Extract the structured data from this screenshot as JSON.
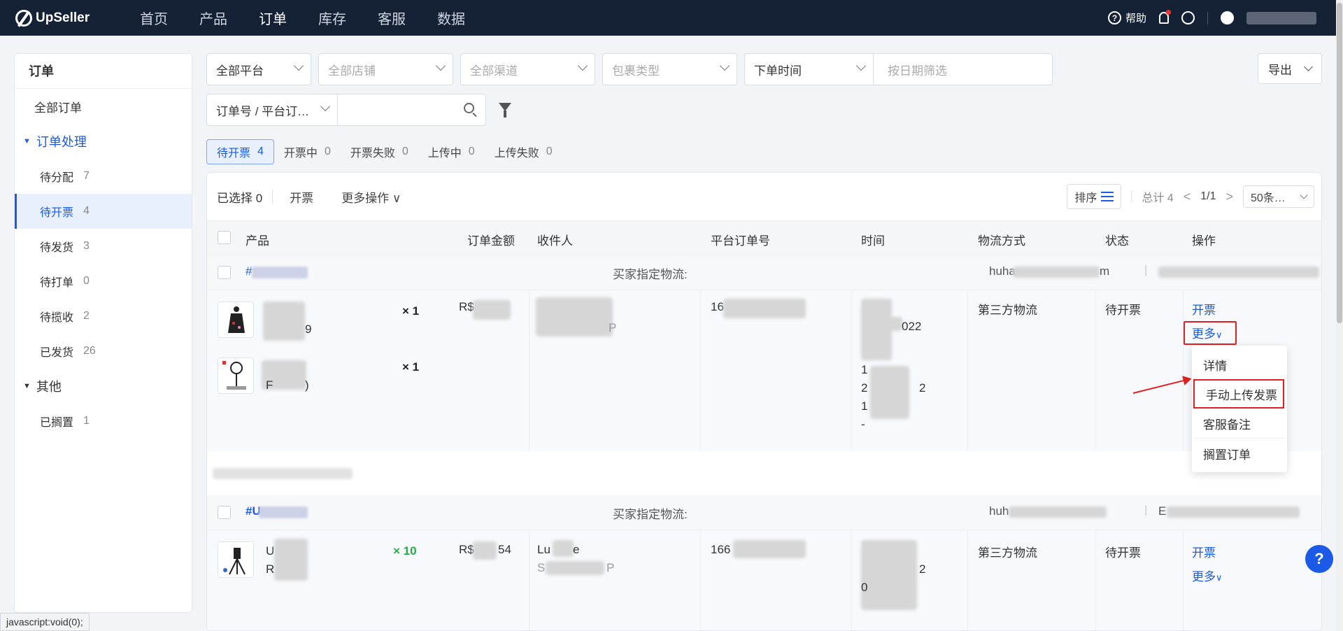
{
  "app": {
    "name": "UpSeller"
  },
  "nav": {
    "items": [
      "首页",
      "产品",
      "订单",
      "库存",
      "客服",
      "数据"
    ],
    "active": "订单"
  },
  "topRight": {
    "help": "帮助"
  },
  "sidebar": {
    "title": "订单",
    "all": "全部订单",
    "group1": "订单处理",
    "items": [
      {
        "label": "待分配",
        "count": "7"
      },
      {
        "label": "待开票",
        "count": "4"
      },
      {
        "label": "待发货",
        "count": "3"
      },
      {
        "label": "待打单",
        "count": "0"
      },
      {
        "label": "待揽收",
        "count": "2"
      },
      {
        "label": "已发货",
        "count": "26"
      }
    ],
    "group2": "其他",
    "other": [
      {
        "label": "已搁置",
        "count": "1"
      }
    ]
  },
  "filters": {
    "platform": "全部平台",
    "store": "全部店铺",
    "channel": "全部渠道",
    "packageType": "包裹类型",
    "timeType": "下单时间",
    "datePlaceholder": "按日期筛选",
    "searchType": "订单号 / 平台订…",
    "export": "导出"
  },
  "tabs": [
    {
      "label": "待开票",
      "count": "4"
    },
    {
      "label": "开票中",
      "count": "0"
    },
    {
      "label": "开票失败",
      "count": "0"
    },
    {
      "label": "上传中",
      "count": "0"
    },
    {
      "label": "上传失败",
      "count": "0"
    }
  ],
  "toolbar": {
    "selected": "已选择 0",
    "invoice": "开票",
    "moreOps": "更多操作",
    "sort": "排序",
    "total": "总计 4",
    "page": "1/1",
    "pageSize": "50条…"
  },
  "table": {
    "headers": [
      "产品",
      "订单金额",
      "收件人",
      "平台订单号",
      "时间",
      "物流方式",
      "状态",
      "操作"
    ]
  },
  "orders": [
    {
      "idPrefix": "#",
      "logisticsLabel": "买家指定物流:",
      "emailPrefix": "huha",
      "emailSuffix": "m",
      "qty1": "× 1",
      "qty2": "× 1",
      "amountPrefix": "R$",
      "recipientSuffix": "P",
      "orderNoPrefix": "16",
      "timeLines": [
        "022",
        "1",
        "2",
        "2",
        "1",
        "-"
      ],
      "skuSuffix1": "9",
      "skuSuffix2": "F",
      "skuSuffix2b": ")",
      "logistics": "第三方物流",
      "status": "待开票",
      "action": "开票",
      "more": "更多"
    },
    {
      "idPrefix": "#U",
      "logisticsLabel": "买家指定物流:",
      "emailPrefix": "huh",
      "extraPrefix": "E",
      "qty": "× 10",
      "amountPrefix": "R$",
      "amountSuffix": "54",
      "recipient": "Lu",
      "recipientSuffix": "e",
      "recipientLine2": "S",
      "recipientLine2Suffix": "P",
      "orderNoPrefix": "166",
      "timeLine": "2",
      "timeLine2": "0",
      "productPrefix": "U",
      "productLine2": "R",
      "logistics": "第三方物流",
      "status": "待开票",
      "action": "开票",
      "more": "更多"
    }
  ],
  "dropdown": {
    "items": [
      "详情",
      "手动上传发票",
      "客服备注",
      "搁置订单"
    ]
  },
  "statusBar": "javascript:void(0);"
}
